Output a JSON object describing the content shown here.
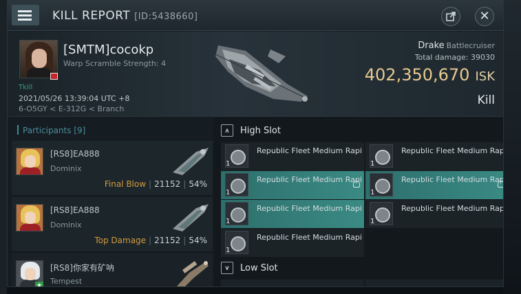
{
  "header": {
    "title": "KILL REPORT",
    "id_text": "[ID:5438660]",
    "share_icon": "share-icon",
    "close_icon": "close-icon"
  },
  "victim": {
    "name": "[SMTM]cocokp",
    "warp_scramble": "Warp Scramble Strength: 4",
    "kill_tag": "Tkill",
    "datetime": "2021/05/26 13:39:04 UTC +8",
    "location": "6-O5GY < E-312G < Branch",
    "ship": "Drake",
    "ship_class": "Battlecruiser",
    "total_damage": "Total damage:  39030",
    "isk_value": "402,350,670",
    "isk_unit": "ISK",
    "result": "Kill"
  },
  "participants": {
    "label": "Participants [9]",
    "items": [
      {
        "name": "[RS8]EA888",
        "ship": "Dominix",
        "role": "Final Blow",
        "damage": "21152",
        "percent": "54%"
      },
      {
        "name": "[RS8]EA888",
        "ship": "Dominix",
        "role": "Top Damage",
        "damage": "21152",
        "percent": "54%"
      },
      {
        "name": "[RS8]你家有矿呐",
        "ship": "Tempest",
        "role": "",
        "damage": "",
        "percent": ""
      }
    ]
  },
  "fitting": {
    "high_slot_label": "High Slot",
    "low_slot_label": "Low Slot",
    "high_modules": [
      {
        "name": "Republic Fleet Medium Rapi",
        "qty": "1",
        "highlight": false
      },
      {
        "name": "Republic Fleet Medium Rapi",
        "qty": "1",
        "highlight": false
      },
      {
        "name": "Republic Fleet Medium Rapi",
        "qty": "1",
        "highlight": true
      },
      {
        "name": "Republic Fleet Medium Rapi",
        "qty": "1",
        "highlight": true
      },
      {
        "name": "Republic Fleet Medium Rapi",
        "qty": "1",
        "highlight": true
      },
      {
        "name": "Republic Fleet Medium Rapi",
        "qty": "1",
        "highlight": false
      },
      {
        "name": "Republic Fleet Medium Rapi",
        "qty": "1",
        "highlight": false
      }
    ]
  },
  "colors": {
    "accent": "#3a8a84",
    "isk": "#e8c98f",
    "role": "#d29a3e"
  }
}
